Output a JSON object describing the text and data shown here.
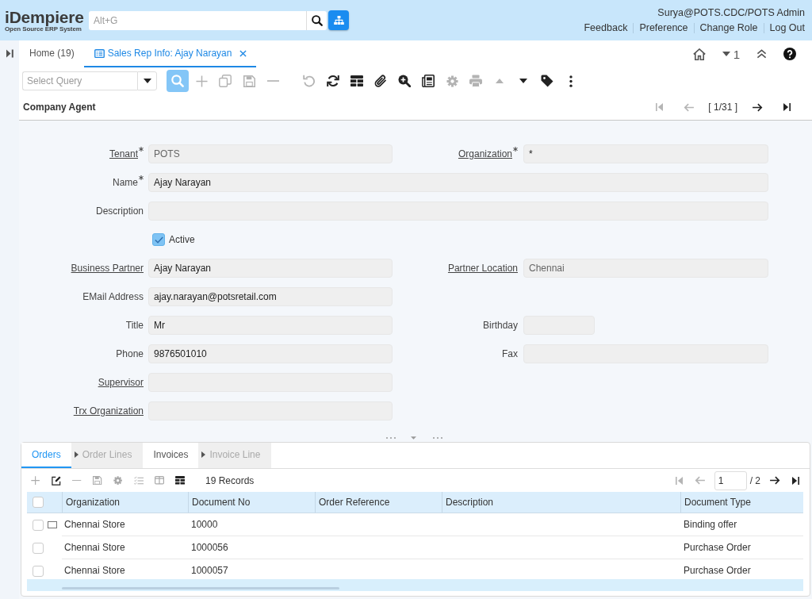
{
  "header": {
    "logo": {
      "name": "iDempiere",
      "tagline": "Open Source ERP System"
    },
    "global_search": {
      "placeholder": "Alt+G"
    },
    "user": "Surya@POTS.CDC/POTS Admin",
    "links": [
      "Feedback",
      "Preference",
      "Change Role",
      "Log Out"
    ]
  },
  "window_tabs": [
    {
      "kind": "home",
      "label": "Home (19)",
      "selected": false
    },
    {
      "kind": "window",
      "label": "Sales Rep Info: Ajay Narayan",
      "selected": true
    }
  ],
  "window_count": "1",
  "toolbar": {
    "query": {
      "placeholder": "Select Query"
    },
    "groups": [
      [
        {
          "kind": "search",
          "active": true,
          "disabled": false
        },
        {
          "kind": "new",
          "active": false,
          "disabled": true
        },
        {
          "kind": "copy",
          "active": false,
          "disabled": true
        },
        {
          "kind": "save",
          "active": false,
          "disabled": true
        },
        {
          "kind": "delete",
          "active": false,
          "disabled": true
        }
      ],
      [
        {
          "kind": "undo",
          "active": false,
          "disabled": true
        },
        {
          "kind": "refresh",
          "active": false,
          "disabled": false
        },
        {
          "kind": "grid",
          "active": false,
          "disabled": false
        },
        {
          "kind": "attach",
          "active": false,
          "disabled": false
        },
        {
          "kind": "zoom",
          "active": false,
          "disabled": false
        },
        {
          "kind": "report",
          "active": false,
          "disabled": false
        },
        {
          "kind": "process",
          "active": false,
          "disabled": true
        },
        {
          "kind": "print",
          "active": false,
          "disabled": true
        },
        {
          "kind": "up",
          "active": false,
          "disabled": true
        },
        {
          "kind": "down",
          "active": false,
          "disabled": false
        },
        {
          "kind": "tag",
          "active": false,
          "disabled": false
        },
        {
          "kind": "more",
          "active": false,
          "disabled": false
        }
      ]
    ]
  },
  "form": {
    "title": "Company Agent",
    "record_nav": [
      {
        "kind": "first",
        "disabled": true
      },
      {
        "kind": "prev",
        "disabled": true
      },
      {
        "kind": "position",
        "label": "[ 1/31 ]"
      },
      {
        "kind": "next",
        "disabled": false
      },
      {
        "kind": "last",
        "disabled": false
      }
    ],
    "rows": [
      [
        {
          "kind": "lookup",
          "label": "Tenant",
          "required": true,
          "link": true,
          "readonly": true,
          "value": "POTS"
        },
        {
          "kind": "lookup",
          "label": "Organization",
          "required": true,
          "link": true,
          "readonly": false,
          "value": "*"
        }
      ],
      [
        {
          "kind": "long_text",
          "label": "Name",
          "required": true,
          "link": false,
          "readonly": false,
          "value": "Ajay Narayan"
        }
      ],
      [
        {
          "kind": "long_text",
          "label": "Description",
          "required": false,
          "link": false
        }
      ],
      [
        {
          "kind": "checkbox",
          "label": "Active",
          "checked": true
        }
      ],
      [
        {
          "kind": "lookup",
          "label": "Business Partner",
          "required": false,
          "link": true,
          "readonly": false,
          "value": "Ajay Narayan"
        },
        {
          "kind": "lookup",
          "label": "Partner Location",
          "required": false,
          "link": true,
          "readonly": true,
          "value": "Chennai"
        }
      ],
      [
        {
          "kind": "text",
          "label": "EMail Address",
          "required": false,
          "link": false,
          "readonly": false,
          "value": "ajay.narayan@potsretail.com"
        }
      ],
      [
        {
          "kind": "text",
          "label": "Title",
          "required": false,
          "link": false,
          "readonly": false,
          "value": "Mr"
        },
        {
          "kind": "date",
          "label": "Birthday",
          "required": false,
          "link": false
        }
      ],
      [
        {
          "kind": "text",
          "label": "Phone",
          "required": false,
          "link": false,
          "readonly": false,
          "value": "9876501010"
        },
        {
          "kind": "text",
          "label": "Fax",
          "required": false,
          "link": false
        }
      ],
      [
        {
          "kind": "lookup",
          "label": "Supervisor",
          "required": false,
          "link": true
        }
      ],
      [
        {
          "kind": "lookup",
          "label": "Trx Organization",
          "required": false,
          "link": true
        }
      ]
    ]
  },
  "detail": {
    "tabs": [
      {
        "label": "Orders",
        "selected": true,
        "disabled": false,
        "children": [
          {
            "label": "Order Lines",
            "selected": false,
            "disabled": true
          }
        ]
      },
      {
        "label": "Invoices",
        "selected": false,
        "disabled": false,
        "children": [
          {
            "label": "Invoice Line",
            "selected": false,
            "disabled": true
          }
        ]
      }
    ],
    "toolbar": [
      {
        "kind": "new",
        "disabled": true
      },
      {
        "kind": "edit",
        "disabled": false
      },
      {
        "kind": "delete",
        "disabled": true
      },
      {
        "kind": "save",
        "disabled": true
      },
      {
        "kind": "process",
        "disabled": true
      },
      {
        "kind": "checklist",
        "disabled": true
      },
      {
        "kind": "columns",
        "disabled": true
      },
      {
        "kind": "grid",
        "disabled": false
      }
    ],
    "record_count": "19 Records",
    "paging": [
      {
        "kind": "first",
        "disabled": true
      },
      {
        "kind": "prev",
        "disabled": true
      },
      {
        "kind": "page",
        "value": "1"
      },
      {
        "kind": "total",
        "label": "/ 2"
      },
      {
        "kind": "next",
        "disabled": false
      },
      {
        "kind": "last",
        "disabled": false
      }
    ],
    "grid": {
      "all_selected": false,
      "columns": {
        "organization": "Organization",
        "document_no": "Document No",
        "order_reference": "Order Reference",
        "description": "Description",
        "document_type": "Document Type"
      },
      "rows": [
        {
          "selected": false,
          "current": true,
          "cells": {
            "organization": "Chennai Store",
            "document_no": "10000",
            "document_type": "Binding offer"
          }
        },
        {
          "selected": false,
          "current": false,
          "cells": {
            "organization": "Chennai Store",
            "document_no": "1000056",
            "document_type": "Purchase Order"
          }
        },
        {
          "selected": false,
          "current": false,
          "cells": {
            "organization": "Chennai Store",
            "document_no": "1000057",
            "document_type": "Purchase Order"
          }
        }
      ]
    }
  }
}
